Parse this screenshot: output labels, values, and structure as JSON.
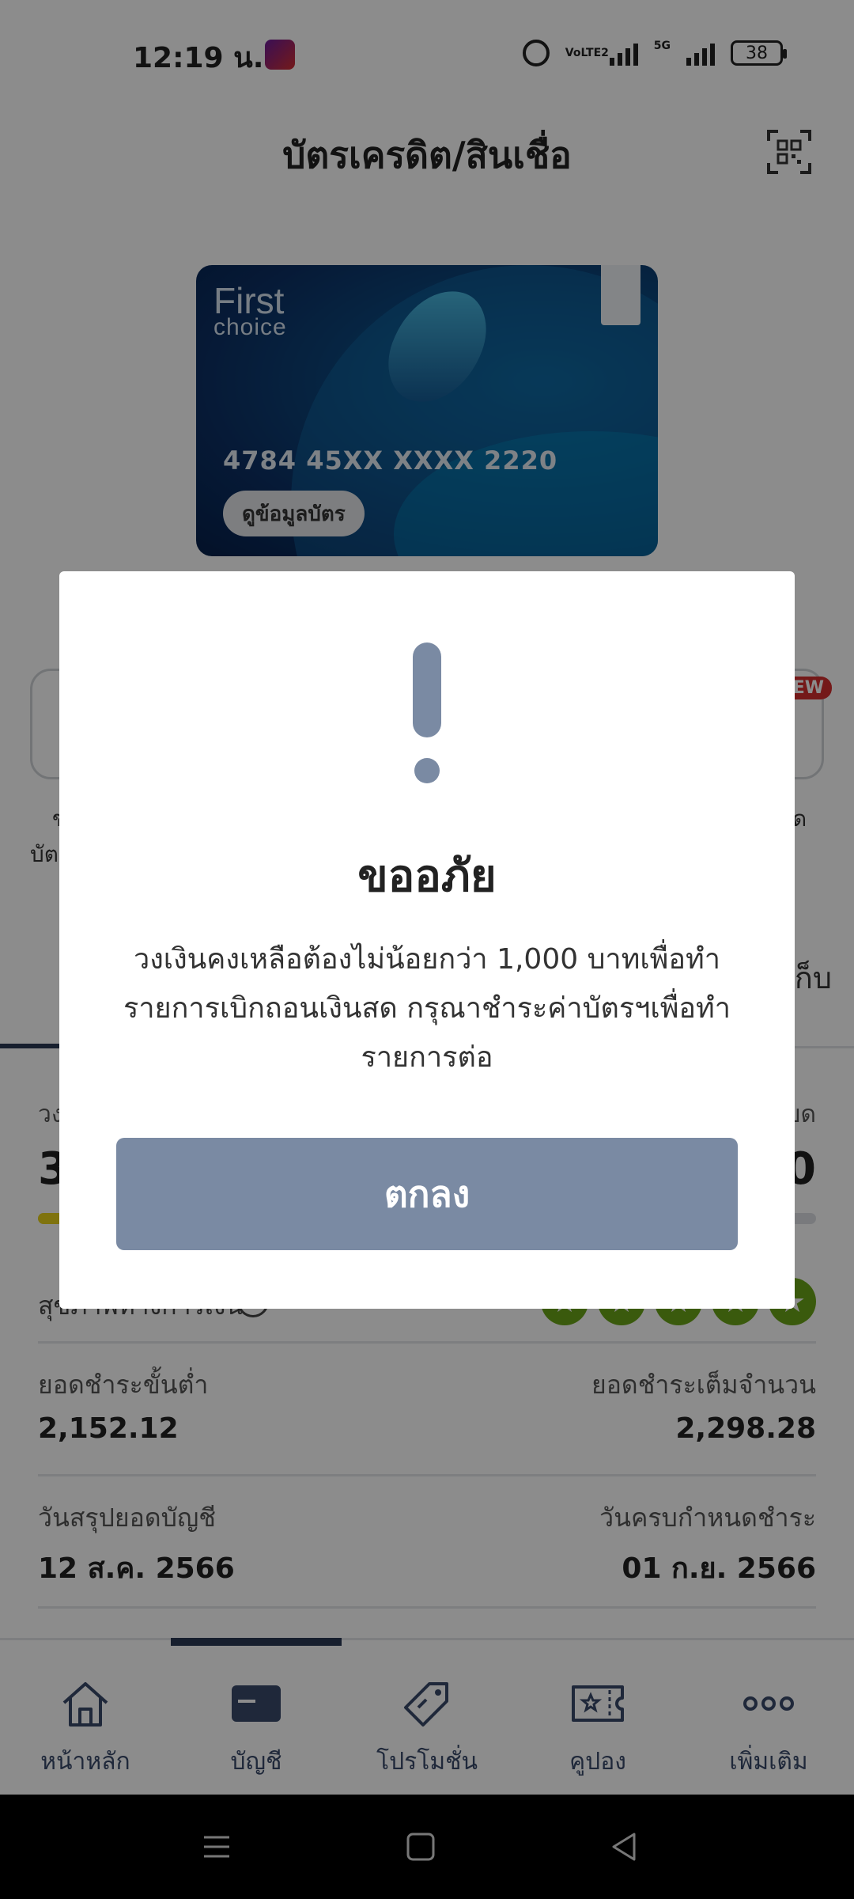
{
  "status_bar": {
    "time": "12:19 น.",
    "network_label": "5G",
    "volte_label": "VoLTE2",
    "battery": "38"
  },
  "header": {
    "title": "บัตรเครดิต/สินเชื่อ"
  },
  "card": {
    "brand_line1": "First",
    "brand_line2": "choice",
    "number": "4784 45XX XXXX 2220",
    "info_button": "ดูข้อมูลบัตร"
  },
  "quick_actions": {
    "partial_label_left_1": "ข",
    "partial_label_left_2": "บัต",
    "partial_label_right": "ด",
    "new_badge": "NEW"
  },
  "tabs": {
    "partial_right_label": "เก็บ"
  },
  "summary": {
    "limit_label_left": "วง",
    "limit_label_right": "ยด",
    "limit_value_left": "3",
    "limit_value_right": "0",
    "health_label": "สุขภาพทางการเงิน",
    "min_payment_label": "ยอดชำระขั้นต่ำ",
    "min_payment_value": "2,152.12",
    "full_payment_label": "ยอดชำระเต็มจำนวน",
    "full_payment_value": "2,298.28",
    "statement_date_label": "วันสรุปยอดบัญชี",
    "statement_date_value": "12 ส.ค. 2566",
    "due_date_label": "วันครบกำหนดชำระ",
    "due_date_value": "01 ก.ย. 2566"
  },
  "bottom_nav": {
    "items": [
      {
        "label": "หน้าหลัก",
        "icon": "home-icon"
      },
      {
        "label": "บัญชี",
        "icon": "card-icon"
      },
      {
        "label": "โปรโมชั่น",
        "icon": "tag-icon"
      },
      {
        "label": "คูปอง",
        "icon": "coupon-icon"
      },
      {
        "label": "เพิ่มเติม",
        "icon": "more-icon"
      }
    ]
  },
  "dialog": {
    "title": "ขออภัย",
    "message": "วงเงินคงเหลือต้องไม่น้อยกว่า 1,000 บาทเพื่อทำรายการเบิกถอนเงินสด กรุณาชำระค่าบัตรฯเพื่อทำรายการต่อ",
    "ok_button": "ตกลง"
  },
  "colors": {
    "accent": "#7a8aa3",
    "nav_active": "#2b3a55",
    "star_green": "#6aa418",
    "limit_bar": "#e8d21a"
  }
}
